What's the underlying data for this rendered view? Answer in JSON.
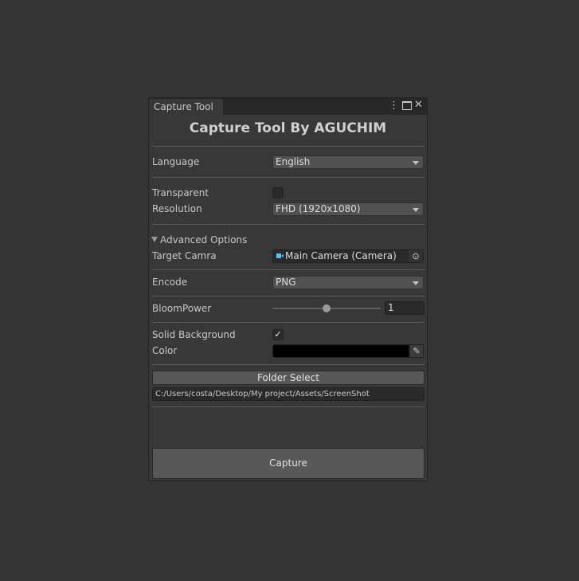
{
  "window": {
    "tab_title": "Capture Tool",
    "heading": "Capture Tool By AGUCHIM"
  },
  "fields": {
    "language_label": "Language",
    "language_value": "English",
    "transparent_label": "Transparent",
    "transparent_checked": false,
    "resolution_label": "Resolution",
    "resolution_value": "FHD (1920x1080)",
    "advanced_label": "Advanced Options",
    "target_camera_label": "Target Camra",
    "target_camera_value": "Main Camera (Camera)",
    "encode_label": "Encode",
    "encode_value": "PNG",
    "bloom_label": "BloomPower",
    "bloom_value": "1",
    "bloom_slider_fraction": 0.5,
    "solid_bg_label": "Solid Background",
    "solid_bg_checked": true,
    "color_label": "Color",
    "color_value": "#000000"
  },
  "folder": {
    "button_label": "Folder Select",
    "path": "C:/Users/costa/Desktop/My project/Assets/ScreenShot"
  },
  "capture_label": "Capture",
  "colors": {
    "camera_icon": "#4fc3f7"
  }
}
